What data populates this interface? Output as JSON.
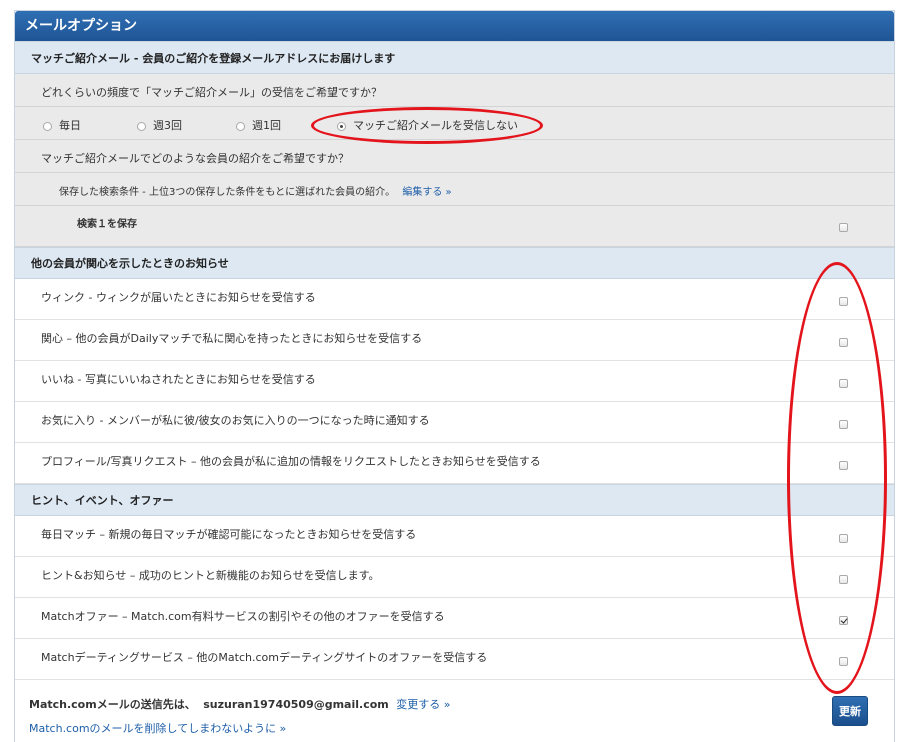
{
  "panel": {
    "title": "メールオプション"
  },
  "match_section": {
    "header": "マッチご紹介メール - 会員のご紹介を登録メールアドレスにお届けします",
    "freq_question": "どれくらいの頻度で「マッチご紹介メール」の受信をご希望ですか？",
    "freq_options": [
      {
        "label": "毎日",
        "selected": false
      },
      {
        "label": "週3回",
        "selected": false
      },
      {
        "label": "週1回",
        "selected": false
      },
      {
        "label": "マッチご紹介メールを受信しない",
        "selected": true
      }
    ],
    "type_question": "マッチご紹介メールでどのような会員の紹介をご希望ですか？",
    "saved_search_text": "保存した検索条件 - 上位3つの保存した条件をもとに選ばれた会員の紹介。",
    "edit_link": "編集する »",
    "saved_search_item": {
      "label": "検索１を保存",
      "checked": false
    }
  },
  "interest_section": {
    "header": "他の会員が関心を示したときのお知らせ",
    "items": [
      {
        "label": "ウィンク - ウィンクが届いたときにお知らせを受信する",
        "checked": false
      },
      {
        "label": "関心 – 他の会員がDailyマッチで私に関心を持ったときにお知らせを受信する",
        "checked": false
      },
      {
        "label": "いいね - 写真にいいねされたときにお知らせを受信する",
        "checked": false
      },
      {
        "label": "お気に入り - メンバーが私に彼/彼女のお気に入りの一つになった時に通知する",
        "checked": false
      },
      {
        "label": "プロフィール/写真リクエスト – 他の会員が私に追加の情報をリクエストしたときお知らせを受信する",
        "checked": false
      }
    ]
  },
  "hints_section": {
    "header": "ヒント、イベント、オファー",
    "items": [
      {
        "label": "毎日マッチ – 新規の毎日マッチが確認可能になったときお知らせを受信する",
        "checked": false
      },
      {
        "label": "ヒント&お知らせ – 成功のヒントと新機能のお知らせを受信します。",
        "checked": false
      },
      {
        "label": "Matchオファー – Match.com有料サービスの割引やその他のオファーを受信する",
        "checked": true
      },
      {
        "label": "Matchデーティングサービス – 他のMatch.comデーティングサイトのオファーを受信する",
        "checked": false
      }
    ]
  },
  "footer": {
    "sender_label": "Match.comメールの送信先は、",
    "email": "suzuran19740509@gmail.com",
    "change_link": "変更する »",
    "prevent_link": "Match.comのメールを削除してしまわないように »",
    "update_button": "更新"
  },
  "annotation_color": "#e3141b"
}
